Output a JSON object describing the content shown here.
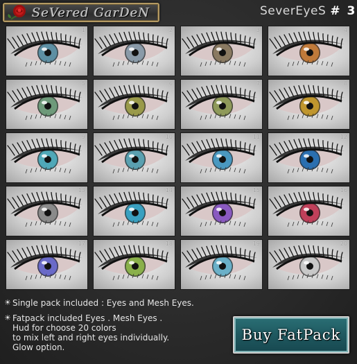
{
  "header": {
    "logo_text": "SeVered GarDeN",
    "logo_icon": "rose-icon",
    "title": "SeverEyeS",
    "title_number": "# 3"
  },
  "eyes": [
    {
      "number": "1",
      "iris": "#5d8fa3"
    },
    {
      "number": "2",
      "iris": "#8a9aa8"
    },
    {
      "number": "3",
      "iris": "#8a7a62"
    },
    {
      "number": "4",
      "iris": "#c07a3a"
    },
    {
      "number": "5",
      "iris": "#6e9a7a"
    },
    {
      "number": "6",
      "iris": "#9a9a4a"
    },
    {
      "number": "7",
      "iris": "#8f9a5a"
    },
    {
      "number": "8",
      "iris": "#c0962e"
    },
    {
      "number": "9",
      "iris": "#4fa8b8"
    },
    {
      "number": "10",
      "iris": "#5aa0b0"
    },
    {
      "number": "11",
      "iris": "#4a98c0"
    },
    {
      "number": "12",
      "iris": "#2a6fb0"
    },
    {
      "number": "13",
      "iris": "#8a8a8a"
    },
    {
      "number": "14",
      "iris": "#3aa0c0"
    },
    {
      "number": "15",
      "iris": "#8a5ac0"
    },
    {
      "number": "16",
      "iris": "#c0405a"
    },
    {
      "number": "17",
      "iris": "#6a6ac8"
    },
    {
      "number": "18",
      "iris": "#8ab04a"
    },
    {
      "number": "19",
      "iris": "#6ab0c8"
    },
    {
      "number": "20",
      "iris": "#c8c8c8"
    }
  ],
  "notes": [
    {
      "lines": [
        "Single pack included : Eyes and Mesh Eyes."
      ]
    },
    {
      "lines": [
        "Fatpack included Eyes . Mesh Eyes .",
        "Hud for choose 20 colors",
        "to mix left and right eyes individually.",
        "Glow option."
      ]
    }
  ],
  "buy_button": {
    "label": "Buy  FatPack"
  },
  "colors": {
    "button_bg": "#1f5960",
    "frame_gold": "#b49a63",
    "background": "#2b2b2b"
  }
}
